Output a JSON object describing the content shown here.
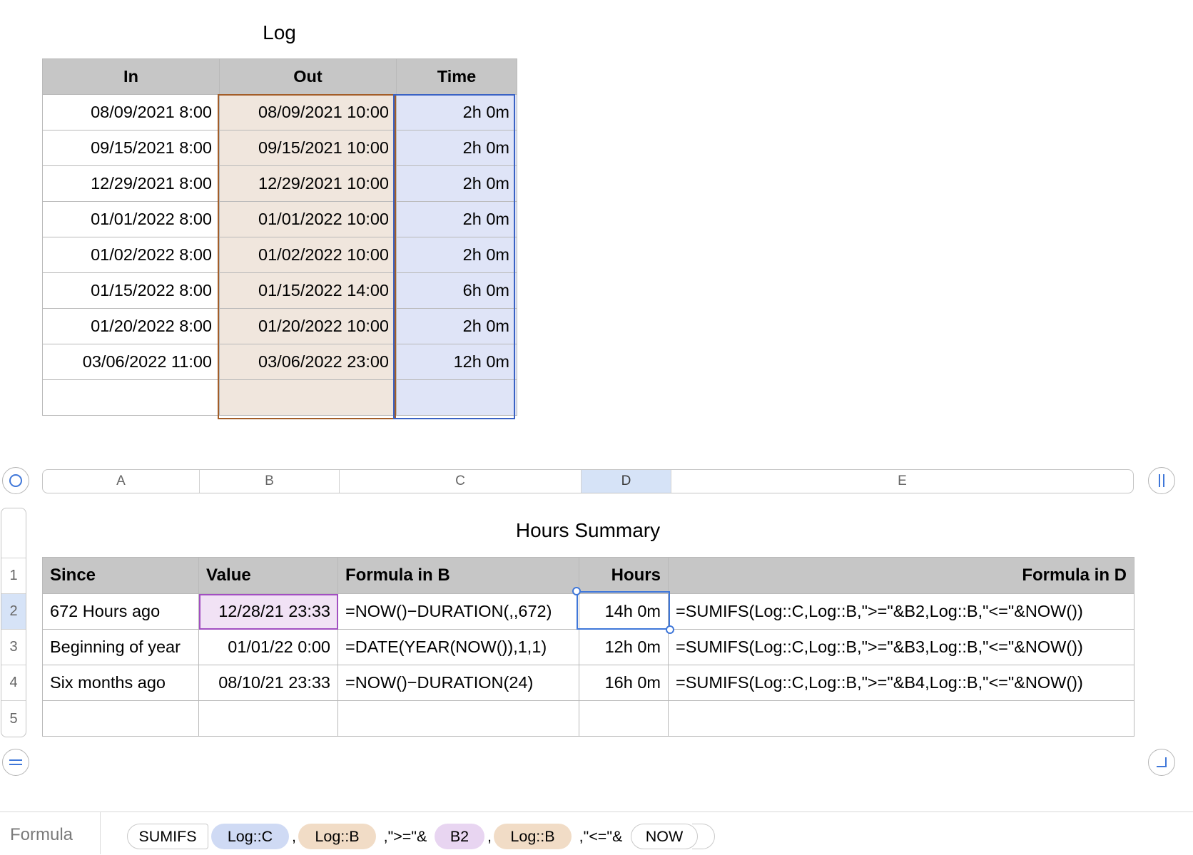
{
  "log": {
    "title": "Log",
    "headers": [
      "In",
      "Out",
      "Time"
    ],
    "rows": [
      [
        "08/09/2021 8:00",
        "08/09/2021 10:00",
        "2h 0m"
      ],
      [
        "09/15/2021 8:00",
        "09/15/2021 10:00",
        "2h 0m"
      ],
      [
        "12/29/2021 8:00",
        "12/29/2021 10:00",
        "2h 0m"
      ],
      [
        "01/01/2022 8:00",
        "01/01/2022 10:00",
        "2h 0m"
      ],
      [
        "01/02/2022 8:00",
        "01/02/2022 10:00",
        "2h 0m"
      ],
      [
        "01/15/2022 8:00",
        "01/15/2022 14:00",
        "6h 0m"
      ],
      [
        "01/20/2022 8:00",
        "01/20/2022 10:00",
        "2h 0m"
      ],
      [
        "03/06/2022 11:00",
        "03/06/2022 23:00",
        "12h 0m"
      ],
      [
        "",
        "",
        ""
      ]
    ],
    "colors": {
      "out_fill": "#f0e6dd",
      "out_border": "#a35d28",
      "time_fill": "#dfe4f7",
      "time_border": "#3a62c4"
    }
  },
  "column_headers": [
    "A",
    "B",
    "C",
    "D",
    "E"
  ],
  "selected_column": "D",
  "row_headers": [
    "1",
    "2",
    "3",
    "4",
    "5"
  ],
  "selected_row": "2",
  "summary": {
    "title": "Hours Summary",
    "headers": [
      "Since",
      "Value",
      "Formula in B",
      "Hours",
      "Formula in D"
    ],
    "rows": [
      [
        "672 Hours ago",
        "12/28/21 23:33",
        "=NOW()−DURATION(,,672)",
        "14h 0m",
        "=SUMIFS(Log::C,Log::B,\">=\"&B2,Log::B,\"<=\"&NOW())"
      ],
      [
        "Beginning of year",
        "01/01/22 0:00",
        "=DATE(YEAR(NOW()),1,1)",
        "12h 0m",
        "=SUMIFS(Log::C,Log::B,\">=\"&B3,Log::B,\"<=\"&NOW())"
      ],
      [
        "Six months ago",
        "08/10/21 23:33",
        "=NOW()−DURATION(24)",
        "16h 0m",
        "=SUMIFS(Log::C,Log::B,\">=\"&B4,Log::B,\"<=\"&NOW())"
      ],
      [
        "",
        "",
        "",
        "",
        ""
      ]
    ],
    "active_cell": "D2"
  },
  "formula_bar": {
    "label": "Formula",
    "tokens": [
      {
        "text": "SUMIFS",
        "kind": "fn"
      },
      {
        "text": "Log::C",
        "kind": "ref-c"
      },
      {
        "text": ",",
        "kind": "text"
      },
      {
        "text": "Log::B",
        "kind": "ref-b"
      },
      {
        "text": ",\">=\"&",
        "kind": "text"
      },
      {
        "text": "B2",
        "kind": "ref-b2"
      },
      {
        "text": ",",
        "kind": "text"
      },
      {
        "text": "Log::B",
        "kind": "ref-b"
      },
      {
        "text": ",\"<=\"&",
        "kind": "text"
      },
      {
        "text": "NOW",
        "kind": "fn"
      }
    ]
  },
  "icons": [
    "select-table-icon",
    "pause-columns-icon",
    "add-rows-icon",
    "resize-table-icon"
  ]
}
